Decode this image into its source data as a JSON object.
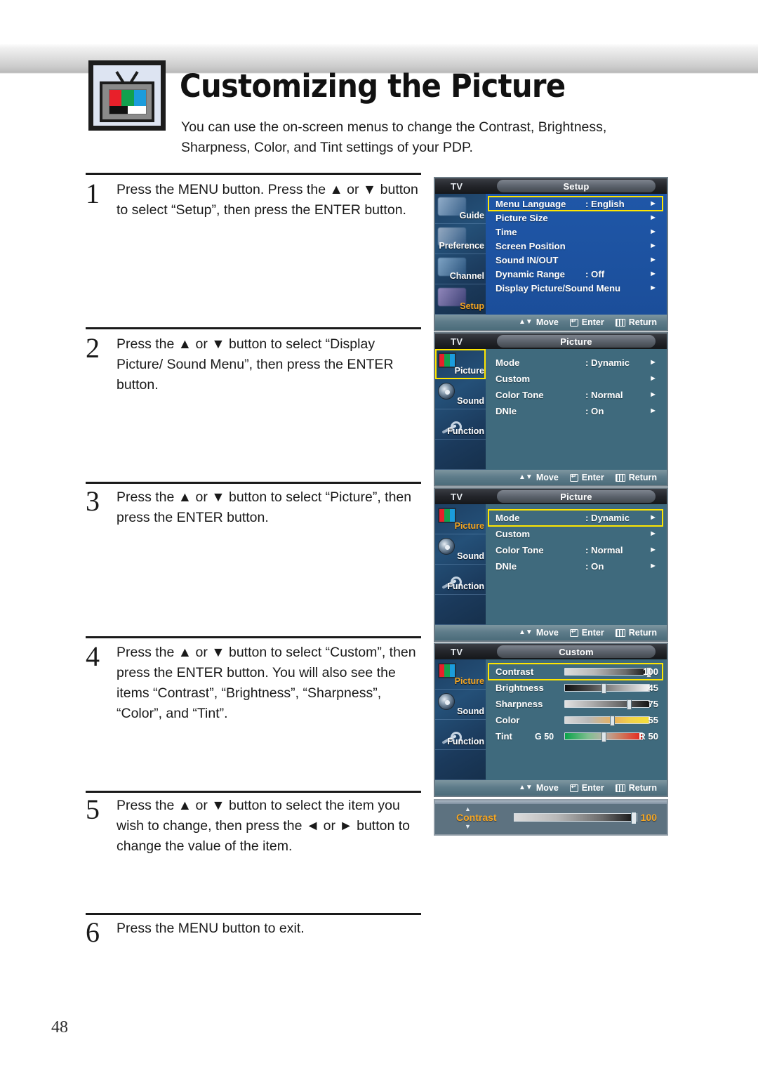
{
  "header": {
    "title": "Customizing the Picture",
    "intro": "You can use the on-screen menus to change the Contrast, Brightness, Sharpness, Color, and Tint settings of your PDP.",
    "icon": "tv-icon"
  },
  "page_number": "48",
  "steps": [
    {
      "number": "1",
      "text": "Press the MENU button. Press the ▲ or ▼ button to select “Setup”, then press the ENTER button."
    },
    {
      "number": "2",
      "text": "Press the ▲ or ▼ button to select “Display Picture/ Sound Menu”, then press the ENTER button."
    },
    {
      "number": "3",
      "text": "Press the ▲ or ▼ button to select “Picture”, then press the ENTER button."
    },
    {
      "number": "4",
      "text": "Press the ▲ or ▼ button to select “Custom”, then press the ENTER button. You will also see the items “Contrast”, “Brightness”, “Sharpness”, “Color”, and “Tint”."
    },
    {
      "number": "5",
      "text": "Press the ▲ or ▼ button to select the item you wish to change, then press the ◄ or ► button to change the value of the item."
    },
    {
      "number": "6",
      "text": "Press the MENU button to exit."
    }
  ],
  "osd_footer": {
    "move": "Move",
    "enter": "Enter",
    "return": "Return"
  },
  "colors": {
    "highlight": "#ffe600",
    "orange": "#f5a623",
    "setup_blue": "#1f57a8",
    "picture_teal": "#3f6a7d"
  },
  "osd_setup": {
    "tv_label": "TV",
    "title": "Setup",
    "sidebar": [
      {
        "label": "Guide",
        "icon": "guide-icon",
        "selected": false
      },
      {
        "label": "Preference",
        "icon": "preference-icon",
        "selected": false
      },
      {
        "label": "Channel",
        "icon": "channel-icon",
        "selected": false
      },
      {
        "label": "Setup",
        "icon": "setup-icon",
        "selected": true
      }
    ],
    "rows": [
      {
        "label": "Menu Language",
        "value": ": English",
        "highlighted": true
      },
      {
        "label": "Picture Size",
        "value": "",
        "highlighted": false
      },
      {
        "label": "Time",
        "value": "",
        "highlighted": false
      },
      {
        "label": "Screen Position",
        "value": "",
        "highlighted": false
      },
      {
        "label": "Sound IN/OUT",
        "value": "",
        "highlighted": false
      },
      {
        "label": "Dynamic Range",
        "value": ":  Off",
        "highlighted": false
      },
      {
        "label": "Display Picture/Sound Menu",
        "value": "",
        "highlighted": false
      }
    ]
  },
  "osd_picture_2": {
    "tv_label": "TV",
    "title": "Picture",
    "sidebar": [
      {
        "label": "Picture",
        "icon": "picture-icon",
        "boxed": true,
        "orange": false
      },
      {
        "label": "Sound",
        "icon": "sound-icon",
        "boxed": false,
        "orange": false
      },
      {
        "label": "Function",
        "icon": "function-icon",
        "boxed": false,
        "orange": false
      }
    ],
    "rows": [
      {
        "label": "Mode",
        "value": ": Dynamic",
        "highlighted": false
      },
      {
        "label": "Custom",
        "value": "",
        "highlighted": false
      },
      {
        "label": "Color Tone",
        "value": ": Normal",
        "highlighted": false
      },
      {
        "label": "DNIe",
        "value": ": On",
        "highlighted": false
      }
    ]
  },
  "osd_picture_3": {
    "tv_label": "TV",
    "title": "Picture",
    "sidebar": [
      {
        "label": "Picture",
        "icon": "picture-icon",
        "boxed": false,
        "orange": true
      },
      {
        "label": "Sound",
        "icon": "sound-icon",
        "boxed": false,
        "orange": false
      },
      {
        "label": "Function",
        "icon": "function-icon",
        "boxed": false,
        "orange": false
      }
    ],
    "rows": [
      {
        "label": "Mode",
        "value": ": Dynamic",
        "highlighted": true
      },
      {
        "label": "Custom",
        "value": "",
        "highlighted": false
      },
      {
        "label": "Color Tone",
        "value": ": Normal",
        "highlighted": false
      },
      {
        "label": "DNIe",
        "value": ": On",
        "highlighted": false
      }
    ]
  },
  "osd_custom": {
    "tv_label": "TV",
    "title": "Custom",
    "sidebar": [
      {
        "label": "Picture",
        "icon": "picture-icon",
        "boxed": false,
        "orange": true
      },
      {
        "label": "Sound",
        "icon": "sound-icon",
        "boxed": false,
        "orange": false
      },
      {
        "label": "Function",
        "icon": "function-icon",
        "boxed": false,
        "orange": false
      }
    ],
    "sliders": [
      {
        "label": "Contrast",
        "prefix": "",
        "value": "100",
        "percent": 100,
        "highlighted": true,
        "gradient": "grad-contrast"
      },
      {
        "label": "Brightness",
        "prefix": "",
        "value": "45",
        "percent": 45,
        "highlighted": false,
        "gradient": "grad-brightness"
      },
      {
        "label": "Sharpness",
        "prefix": "",
        "value": "75",
        "percent": 75,
        "highlighted": false,
        "gradient": "grad-sharpness"
      },
      {
        "label": "Color",
        "prefix": "",
        "value": "55",
        "percent": 55,
        "highlighted": false,
        "gradient": "grad-color"
      },
      {
        "label": "Tint",
        "prefix": "G 50",
        "value": "R 50",
        "percent": 50,
        "highlighted": false,
        "gradient": "grad-tint"
      }
    ]
  },
  "osd_contrast_bar": {
    "label": "Contrast",
    "value": "100",
    "percent": 100,
    "up_arrow": "▲",
    "down_arrow": "▼"
  }
}
